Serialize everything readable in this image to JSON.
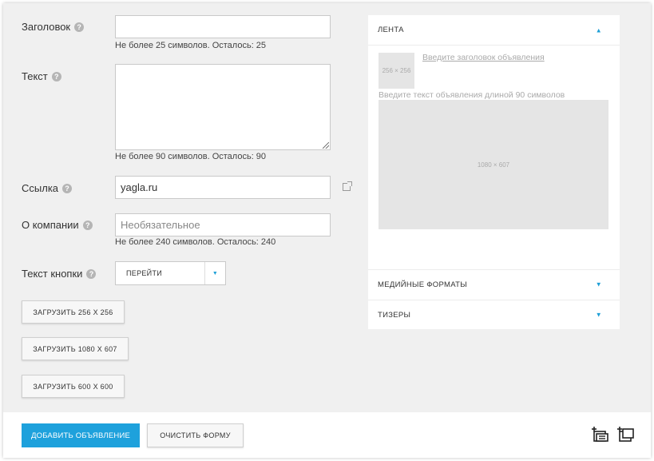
{
  "form": {
    "title": {
      "label": "Заголовок",
      "value": "",
      "hint": "Не более 25 символов. Осталось: 25"
    },
    "text": {
      "label": "Текст",
      "value": "",
      "hint": "Не более 90 символов. Осталось: 90"
    },
    "link": {
      "label": "Ссылка",
      "value": "yagla.ru"
    },
    "company": {
      "label": "О компании",
      "placeholder": "Необязательное",
      "hint": "Не более 240 символов. Осталось: 240"
    },
    "button_text": {
      "label": "Текст кнопки",
      "selected": "ПЕРЕЙТИ"
    },
    "help_glyph": "?"
  },
  "uploads": {
    "u256": "ЗАГРУЗИТЬ 256 Х 256",
    "u1080": "ЗАГРУЗИТЬ 1080 Х 607",
    "u600": "ЗАГРУЗИТЬ 600 Х 600"
  },
  "preview": {
    "sections": {
      "feed": "ЛЕНТА",
      "media": "МЕДИЙНЫЕ ФОРМАТЫ",
      "teasers": "ТИЗЕРЫ"
    },
    "thumb_size": "256 × 256",
    "title_placeholder": "Введите заголовок объявления",
    "text_placeholder": "Введите текст объявления длиной 90 символов",
    "image_size": "1080 × 607"
  },
  "footer": {
    "add": "ДОБАВИТЬ ОБЪЯВЛЕНИЕ",
    "clear": "ОЧИСТИТЬ ФОРМУ"
  },
  "colors": {
    "accent": "#1ea1dc",
    "background": "#f0f0f0"
  },
  "icons": [
    "help-icon",
    "external-link-icon",
    "chevron-down-icon",
    "chevron-up-icon",
    "add-block-icon",
    "add-slide-icon"
  ]
}
